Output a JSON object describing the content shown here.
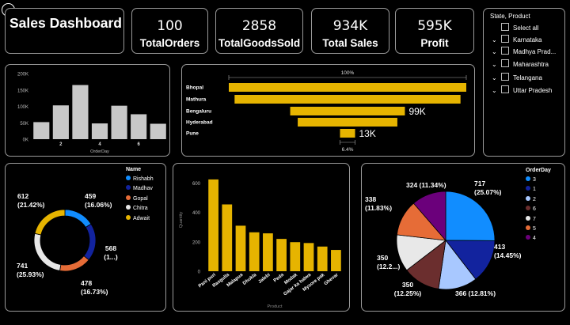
{
  "title": "Sales Dashboard",
  "kpis": [
    {
      "value": "100",
      "label": "TotalOrders"
    },
    {
      "value": "2858",
      "label": "TotalGoodsSold"
    },
    {
      "value": "934K",
      "label": "Total Sales"
    },
    {
      "value": "595K",
      "label": "Profit"
    }
  ],
  "slicer": {
    "title": "State, Product",
    "items": [
      "Select all",
      "Karnataka",
      "Madhya Prad...",
      "Maharashtra",
      "Telangana",
      "Uttar Pradesh"
    ]
  },
  "colors": {
    "accent": "#e6b400",
    "bars": "#c8c8c8"
  },
  "chart_data": [
    {
      "type": "bar",
      "xlabel": "OrderDay",
      "x_ticks": [
        "2",
        "4",
        "6"
      ],
      "y_ticks": [
        "0K",
        "50K",
        "100K",
        "150K",
        "200K"
      ],
      "ylim": [
        0,
        200000
      ],
      "values": [
        52000,
        103000,
        165000,
        48000,
        102000,
        76000,
        47000
      ],
      "grid": false
    },
    {
      "type": "bar",
      "subtype": "funnel",
      "categories": [
        "Bhopal",
        "Mathura",
        "Bengaluru",
        "Hyderabad",
        "Pune"
      ],
      "values": [
        205000,
        195000,
        99000,
        86000,
        13000
      ],
      "top_label": "100%",
      "bottom_label": "6.4%",
      "data_labels": {
        "Bengaluru": "99K",
        "Pune": "13K"
      }
    },
    {
      "type": "pie",
      "subtype": "donut",
      "legend_title": "Name",
      "legend_position": "right",
      "labels": [
        "Rishabh",
        "Madhav",
        "Gopal",
        "Chitra",
        "Adwait"
      ],
      "values": [
        459,
        568,
        478,
        741,
        612
      ],
      "data_labels": [
        [
          "459",
          "(16.06%)"
        ],
        [
          "568",
          "(1...)"
        ],
        [
          "478",
          "(16.73%)"
        ],
        [
          "741",
          "(25.93%)"
        ],
        [
          "612",
          "(21.42%)"
        ]
      ],
      "colors": [
        "#118dff",
        "#12239e",
        "#e66c37",
        "#e8e8e8",
        "#e6b400"
      ]
    },
    {
      "type": "bar",
      "xlabel": "Product",
      "ylabel": "Quantity",
      "categories": [
        "Pani puri",
        "Rasgulla",
        "Malapua",
        "Dhokla",
        "Jalebi",
        "Peda",
        "Modak",
        "Gajar ka halwa",
        "Mysore pak",
        "Ghevar"
      ],
      "values": [
        625,
        455,
        310,
        265,
        258,
        220,
        198,
        192,
        168,
        145
      ],
      "y_ticks": [
        "0",
        "200",
        "400",
        "600"
      ],
      "ylim": [
        0,
        700
      ]
    },
    {
      "type": "pie",
      "legend_title": "OrderDay",
      "legend_position": "right",
      "labels": [
        "3",
        "1",
        "2",
        "6",
        "7",
        "5",
        "4"
      ],
      "values": [
        717,
        413,
        366,
        350,
        350,
        338,
        324
      ],
      "data_labels": [
        [
          "717",
          "(25.07%)"
        ],
        [
          "413",
          "(14.45%)"
        ],
        [
          "366 (12.81%)"
        ],
        [
          "350",
          "(12.25%)"
        ],
        [
          "350",
          "(12.2...)"
        ],
        [
          "338",
          "(11.83%)"
        ],
        [
          "324 (11.34%)"
        ]
      ],
      "colors": [
        "#118dff",
        "#12239e",
        "#a8c8ff",
        "#6b2e2e",
        "#e8e8e8",
        "#e66c37",
        "#6b007b"
      ]
    }
  ]
}
